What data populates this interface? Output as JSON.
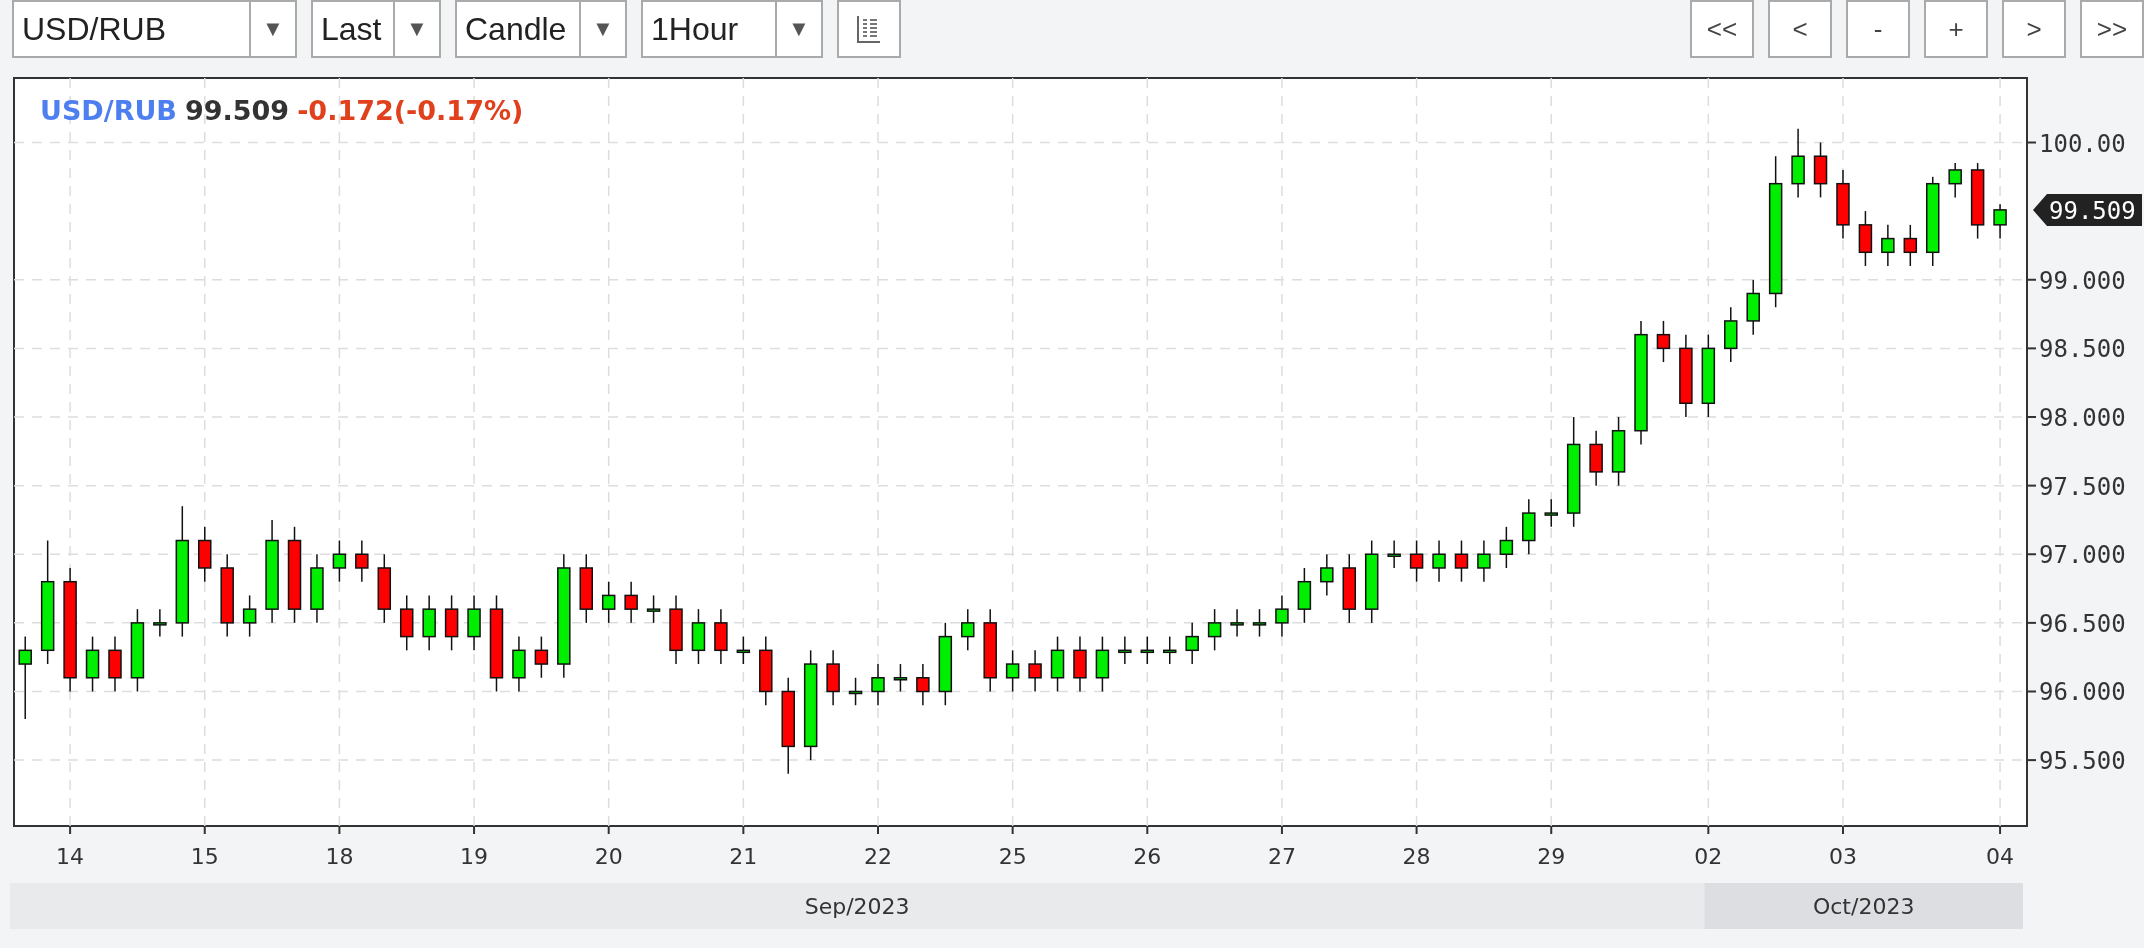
{
  "toolbar": {
    "selects": [
      {
        "value": "USD/RUB",
        "arrow": "▼"
      },
      {
        "value": "Last",
        "arrow": "▼"
      },
      {
        "value": "Candle",
        "arrow": "▼"
      },
      {
        "value": "1Hour",
        "arrow": "▼"
      }
    ],
    "buttons": [
      "<<",
      "<",
      "-",
      "+",
      ">",
      ">>"
    ]
  },
  "chart": {
    "header": {
      "symbol": "USD/RUB",
      "price": "99.509",
      "change": "-0.172(-0.17%)"
    },
    "last_price_tag": "99.509",
    "months": [
      {
        "label": "Sep/2023",
        "highlighted": false
      },
      {
        "label": "Oct/2023",
        "highlighted": true
      }
    ],
    "chart_data": {
      "type": "candlestick",
      "grid": true,
      "ylim": [
        95.02,
        100.47
      ],
      "yticks": [
        {
          "value": 95.5,
          "label": "95.500"
        },
        {
          "value": 96,
          "label": "96.000"
        },
        {
          "value": 96.5,
          "label": "96.500"
        },
        {
          "value": 97,
          "label": "97.000"
        },
        {
          "value": 97.5,
          "label": "97.500"
        },
        {
          "value": 98,
          "label": "98.000"
        },
        {
          "value": 98.5,
          "label": "98.500"
        },
        {
          "value": 99,
          "label": "99.000"
        },
        {
          "value": 100,
          "label": "100.00"
        }
      ],
      "categories": [
        null,
        null,
        "14",
        null,
        null,
        null,
        null,
        null,
        "15",
        null,
        null,
        null,
        null,
        null,
        "18",
        null,
        null,
        null,
        null,
        null,
        "19",
        null,
        null,
        null,
        null,
        null,
        "20",
        null,
        null,
        null,
        null,
        null,
        "21",
        null,
        null,
        null,
        null,
        null,
        "22",
        null,
        null,
        null,
        null,
        null,
        "25",
        null,
        null,
        null,
        null,
        null,
        "26",
        null,
        null,
        null,
        null,
        null,
        "27",
        null,
        null,
        null,
        null,
        null,
        "28",
        null,
        null,
        null,
        null,
        null,
        "29",
        null,
        null,
        null,
        null,
        null,
        null,
        "02",
        null,
        null,
        null,
        null,
        null,
        "03",
        null,
        null,
        null,
        null,
        null,
        null,
        "04"
      ],
      "ohlc": [
        [
          96.2,
          96.4,
          95.8,
          96.3
        ],
        [
          96.3,
          97.1,
          96.2,
          96.8
        ],
        [
          96.8,
          96.9,
          96.0,
          96.1
        ],
        [
          96.1,
          96.4,
          96.0,
          96.3
        ],
        [
          96.3,
          96.4,
          96.0,
          96.1
        ],
        [
          96.1,
          96.6,
          96.0,
          96.5
        ],
        [
          96.5,
          96.6,
          96.4,
          96.5
        ],
        [
          96.5,
          97.35,
          96.4,
          97.1
        ],
        [
          97.1,
          97.2,
          96.8,
          96.9
        ],
        [
          96.9,
          97.0,
          96.4,
          96.5
        ],
        [
          96.5,
          96.7,
          96.4,
          96.6
        ],
        [
          96.6,
          97.25,
          96.5,
          97.1
        ],
        [
          97.1,
          97.2,
          96.5,
          96.6
        ],
        [
          96.6,
          97.0,
          96.5,
          96.9
        ],
        [
          96.9,
          97.1,
          96.8,
          97.0
        ],
        [
          97.0,
          97.1,
          96.8,
          96.9
        ],
        [
          96.9,
          97.0,
          96.5,
          96.6
        ],
        [
          96.6,
          96.7,
          96.3,
          96.4
        ],
        [
          96.4,
          96.7,
          96.3,
          96.6
        ],
        [
          96.6,
          96.7,
          96.3,
          96.4
        ],
        [
          96.4,
          96.7,
          96.3,
          96.6
        ],
        [
          96.6,
          96.7,
          96.0,
          96.1
        ],
        [
          96.1,
          96.4,
          96.0,
          96.3
        ],
        [
          96.3,
          96.4,
          96.1,
          96.2
        ],
        [
          96.2,
          97.0,
          96.1,
          96.9
        ],
        [
          96.9,
          97.0,
          96.5,
          96.6
        ],
        [
          96.6,
          96.8,
          96.5,
          96.7
        ],
        [
          96.7,
          96.8,
          96.5,
          96.6
        ],
        [
          96.6,
          96.7,
          96.5,
          96.6
        ],
        [
          96.6,
          96.7,
          96.2,
          96.3
        ],
        [
          96.3,
          96.6,
          96.2,
          96.5
        ],
        [
          96.5,
          96.6,
          96.2,
          96.3
        ],
        [
          96.3,
          96.4,
          96.2,
          96.3
        ],
        [
          96.3,
          96.4,
          95.9,
          96.0
        ],
        [
          96.0,
          96.1,
          95.4,
          95.6
        ],
        [
          95.6,
          96.3,
          95.5,
          96.2
        ],
        [
          96.2,
          96.3,
          95.9,
          96.0
        ],
        [
          96.0,
          96.1,
          95.9,
          96.0
        ],
        [
          96.0,
          96.2,
          95.9,
          96.1
        ],
        [
          96.1,
          96.2,
          96.0,
          96.1
        ],
        [
          96.1,
          96.2,
          95.9,
          96.0
        ],
        [
          96.0,
          96.5,
          95.9,
          96.4
        ],
        [
          96.4,
          96.6,
          96.3,
          96.5
        ],
        [
          96.5,
          96.6,
          96.0,
          96.1
        ],
        [
          96.1,
          96.3,
          96.0,
          96.2
        ],
        [
          96.2,
          96.3,
          96.0,
          96.1
        ],
        [
          96.1,
          96.4,
          96.0,
          96.3
        ],
        [
          96.3,
          96.4,
          96.0,
          96.1
        ],
        [
          96.1,
          96.4,
          96.0,
          96.3
        ],
        [
          96.3,
          96.4,
          96.2,
          96.3
        ],
        [
          96.3,
          96.4,
          96.2,
          96.3
        ],
        [
          96.3,
          96.4,
          96.2,
          96.3
        ],
        [
          96.3,
          96.5,
          96.2,
          96.4
        ],
        [
          96.4,
          96.6,
          96.3,
          96.5
        ],
        [
          96.5,
          96.6,
          96.4,
          96.5
        ],
        [
          96.5,
          96.6,
          96.4,
          96.5
        ],
        [
          96.5,
          96.7,
          96.4,
          96.6
        ],
        [
          96.6,
          96.9,
          96.5,
          96.8
        ],
        [
          96.8,
          97.0,
          96.7,
          96.9
        ],
        [
          96.9,
          97.0,
          96.5,
          96.6
        ],
        [
          96.6,
          97.1,
          96.5,
          97.0
        ],
        [
          97.0,
          97.1,
          96.9,
          97.0
        ],
        [
          97.0,
          97.1,
          96.8,
          96.9
        ],
        [
          96.9,
          97.1,
          96.8,
          97.0
        ],
        [
          97.0,
          97.1,
          96.8,
          96.9
        ],
        [
          96.9,
          97.1,
          96.8,
          97.0
        ],
        [
          97.0,
          97.2,
          96.9,
          97.1
        ],
        [
          97.1,
          97.4,
          97.0,
          97.3
        ],
        [
          97.3,
          97.4,
          97.2,
          97.3
        ],
        [
          97.3,
          98.0,
          97.2,
          97.8
        ],
        [
          97.8,
          97.9,
          97.5,
          97.6
        ],
        [
          97.6,
          98.0,
          97.5,
          97.9
        ],
        [
          97.9,
          98.7,
          97.8,
          98.6
        ],
        [
          98.6,
          98.7,
          98.4,
          98.5
        ],
        [
          98.5,
          98.6,
          98.0,
          98.1
        ],
        [
          98.1,
          98.6,
          98.0,
          98.5
        ],
        [
          98.5,
          98.8,
          98.4,
          98.7
        ],
        [
          98.7,
          99.0,
          98.6,
          98.9
        ],
        [
          98.9,
          99.9,
          98.8,
          99.7
        ],
        [
          99.7,
          100.1,
          99.6,
          99.9
        ],
        [
          99.9,
          100.0,
          99.6,
          99.7
        ],
        [
          99.7,
          99.8,
          99.3,
          99.4
        ],
        [
          99.4,
          99.5,
          99.1,
          99.2
        ],
        [
          99.2,
          99.4,
          99.1,
          99.3
        ],
        [
          99.3,
          99.4,
          99.1,
          99.2
        ],
        [
          99.2,
          99.75,
          99.1,
          99.7
        ],
        [
          99.7,
          99.85,
          99.6,
          99.8
        ],
        [
          99.8,
          99.85,
          99.3,
          99.4
        ],
        [
          99.4,
          99.55,
          99.3,
          99.509
        ]
      ]
    }
  }
}
